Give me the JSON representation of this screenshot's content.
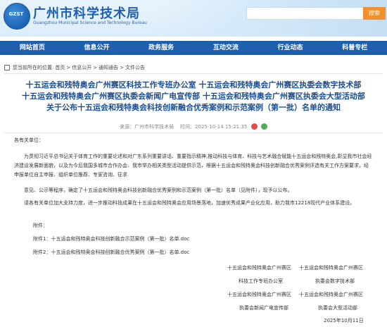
{
  "header": {
    "logo_text": "GZST",
    "site_title": "广州市科学技术局",
    "site_subtitle": "Guangzhou Municipal Science and Technology Bureau",
    "search_button": "搜索",
    "search_placeholder": ""
  },
  "nav": {
    "items": [
      "网站首页",
      "信息公开",
      "政务服务",
      "互动交流",
      "行业动态",
      "科普专栏"
    ]
  },
  "breadcrumb": {
    "prefix": "您当前所在的位置:",
    "items": [
      "首页",
      "信息公开",
      "通知通告",
      "文件公告"
    ],
    "separator": ">"
  },
  "article": {
    "title_lines": [
      "十五运会和残特奥会广州赛区科技工作专班办公室 十五运会和残特奥会广州赛区执委会数字技术部",
      "十五运会和残特奥会广州赛区执委会新闻广电宣传部 十五运会和残特奥会广州赛区执委会大型活动部",
      "关于公布十五运会和残特奥会科技创新融合优秀案例和示范案例（第一批）名单的通知"
    ],
    "source_label": "来源：",
    "source": "广州市科学技术局",
    "time_label": "时间：",
    "time": "2025-10-14 15:21:35",
    "salutation": "各有关单位：",
    "paragraphs": [
      "为贯彻习近平总书记关于体育工作的重要论述和对广东系列重要讲话、重要指示精神,推动科技与体育、科技与艺术融合赋能十五运会和残特奥会,彰显我市社会经济建设发展新面貌，以及为今后我国多城市合作办会、我市举办相关类型活动提供示范，根据十五运会和残特奥会科技创新融合优秀案例评选有关工作方案要求，经申报单位自主申报、组织单位推荐、专家咨询、征求",
      "意见、公示等程序，确定了十五运会和残特奥会科技创新融合优秀案例和示范案例（第一批）名单（见附件），现予以公布。",
      "请各有关单位加大支持力度，进一步推动科技成果在十五运会和残特奥会应用场景落地，加速优秀成果产业化应用，助力我市12218现代产业体系建设。"
    ],
    "attachments_label": "附件：",
    "attachments": [
      "附件1：十五运会和残特奥会科技创新融合示范案例（第一批）名单.doc",
      "附件2：十五运会和残特奥会科技创新融合优秀案例（第一批）名单.doc"
    ],
    "signatures": [
      [
        "十五运会和残特奥会广州赛区",
        "十五运会和残特奥会广州赛区"
      ],
      [
        "科技工作专班办公室",
        "执委会数字技术部"
      ],
      [
        "十五运会和残特奥会广州赛区",
        "十五运会和残特奥会广州赛区"
      ],
      [
        "执委会新闻广电宣传部",
        "执委会大型活动部"
      ]
    ],
    "date": "2025年10月11日"
  },
  "colors": {
    "brand_blue": "#1e5fae",
    "title_blue": "#1a4d91",
    "search_orange": "#f0902e"
  }
}
